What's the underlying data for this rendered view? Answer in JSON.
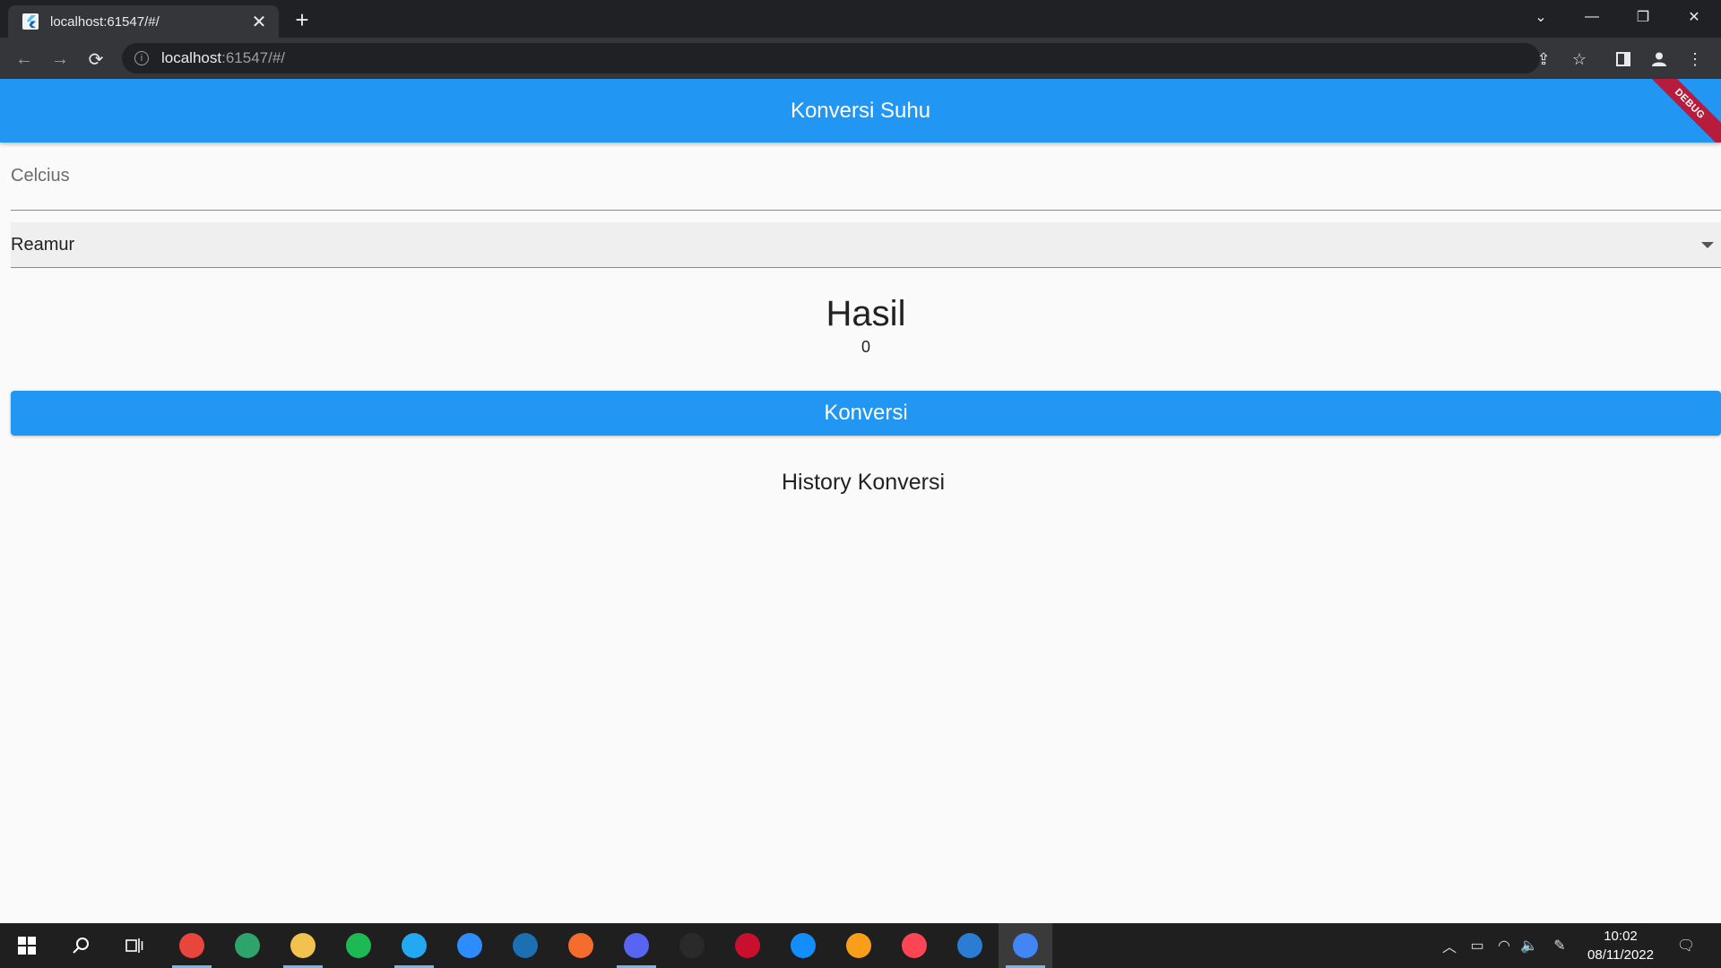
{
  "browser": {
    "tab_title": "localhost:61547/#/",
    "url_host": "localhost",
    "url_rest": ":61547/#/"
  },
  "app": {
    "title": "Konversi Suhu",
    "debug_banner": "DEBUG",
    "input": {
      "placeholder": "Celcius",
      "value": ""
    },
    "dropdown": {
      "selected": "Reamur"
    },
    "result_title": "Hasil",
    "result_value": "0",
    "convert_button": "Konversi",
    "history_title": "History Konversi"
  },
  "taskbar": {
    "apps": [
      {
        "name": "chrome-profile",
        "color": "#e8453c"
      },
      {
        "name": "edge",
        "color": "#2ea36b"
      },
      {
        "name": "file-explorer",
        "color": "#f2c14e"
      },
      {
        "name": "spotify",
        "color": "#1db954"
      },
      {
        "name": "vscode",
        "color": "#23a9f2"
      },
      {
        "name": "zoom",
        "color": "#2d8cff"
      },
      {
        "name": "steam",
        "color": "#1b6fb3"
      },
      {
        "name": "origin",
        "color": "#f56c2d"
      },
      {
        "name": "discord",
        "color": "#5865f2"
      },
      {
        "name": "epic-games",
        "color": "#2a2a2a"
      },
      {
        "name": "racing-game",
        "color": "#c8102e"
      },
      {
        "name": "battle-net",
        "color": "#148eff"
      },
      {
        "name": "overwatch",
        "color": "#f99e1a"
      },
      {
        "name": "valorant",
        "color": "#fd4556"
      },
      {
        "name": "word-app",
        "color": "#2b7cd3"
      },
      {
        "name": "chrome",
        "color": "#4285f4"
      }
    ],
    "clock_time": "10:02",
    "clock_date": "08/11/2022"
  }
}
